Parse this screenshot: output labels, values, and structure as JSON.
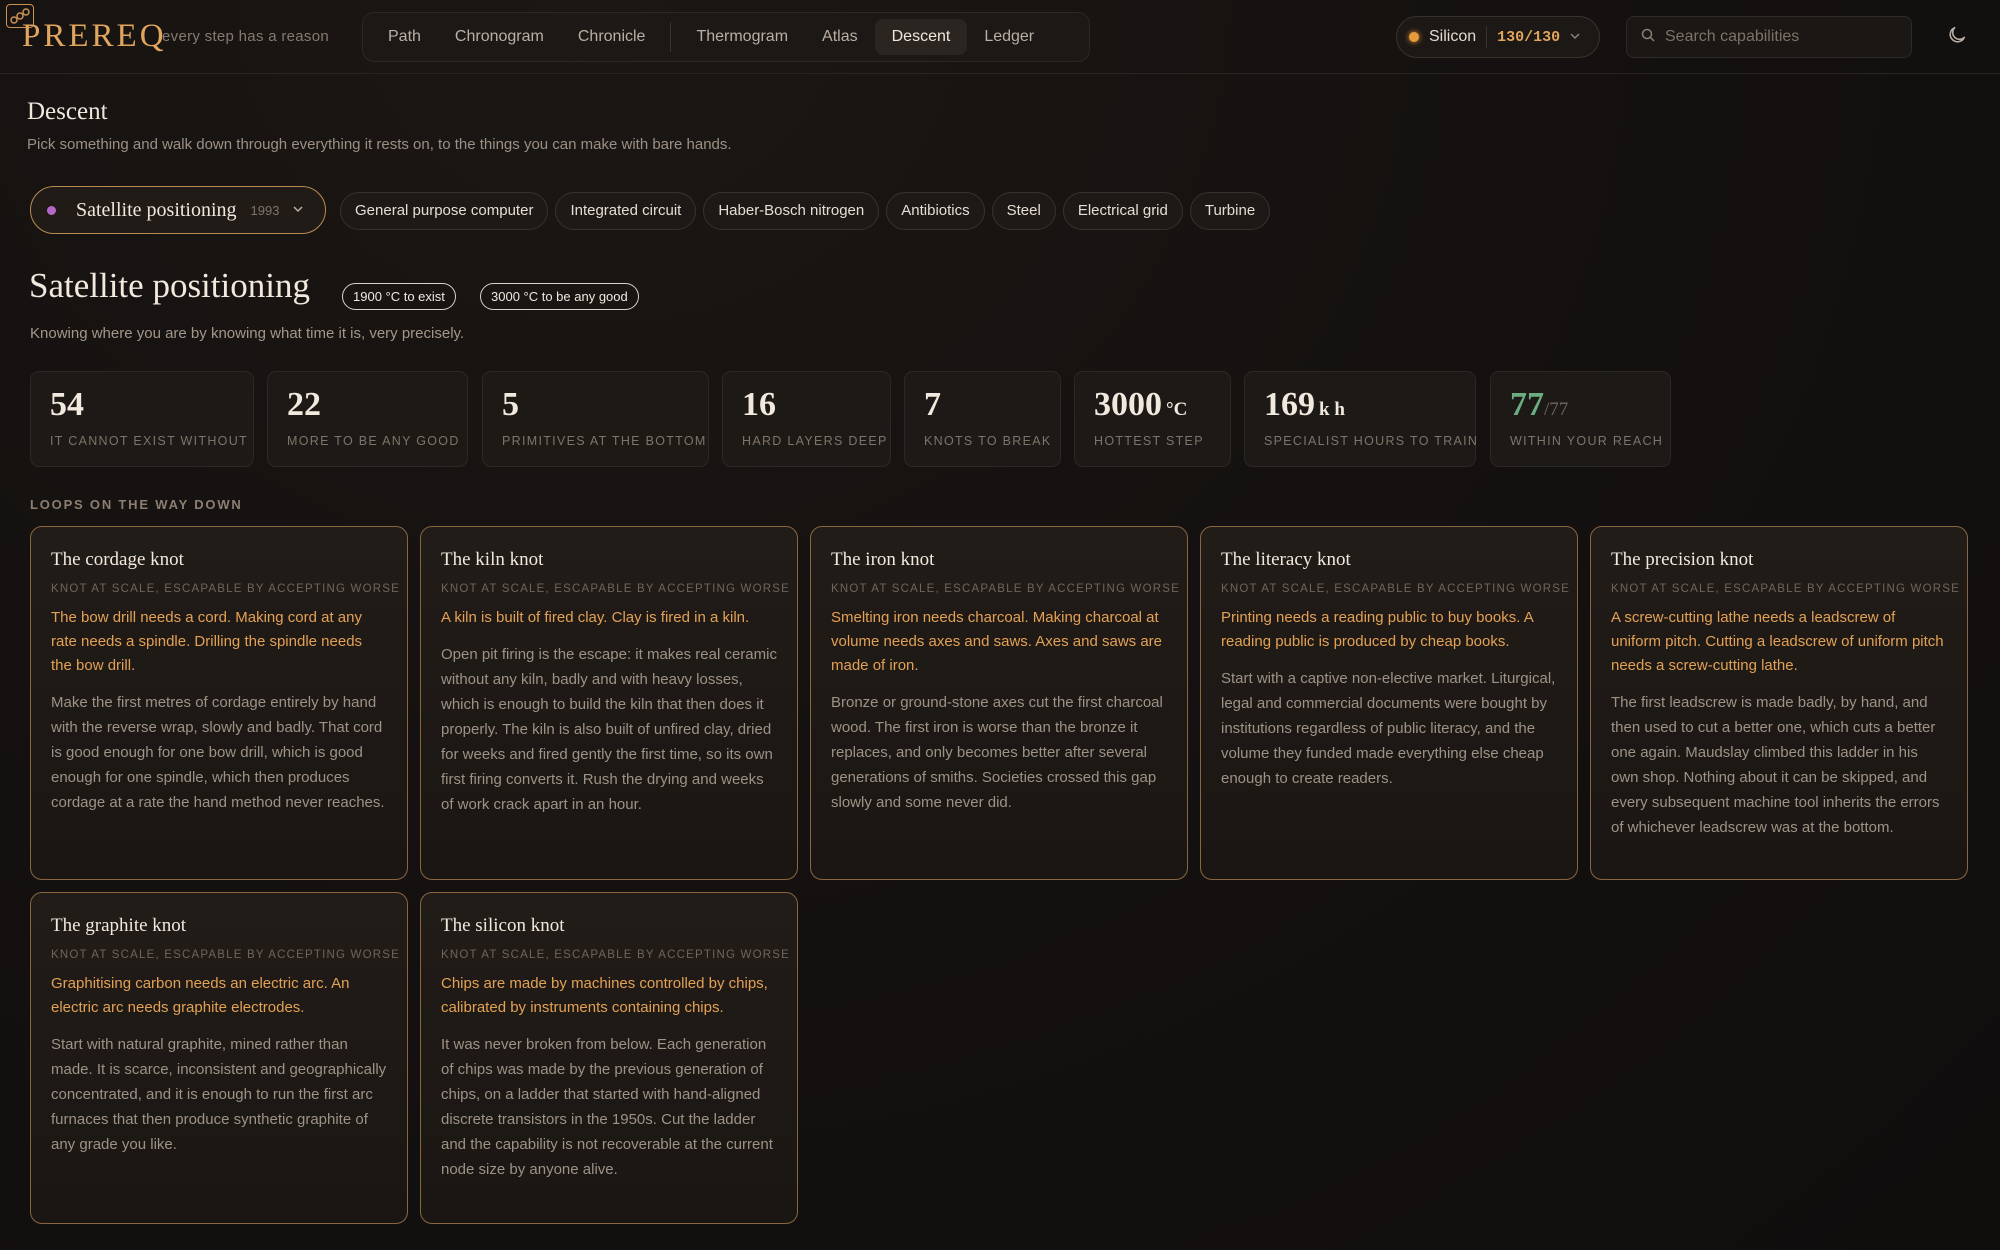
{
  "app": {
    "logo": "PREREQ",
    "tagline": "every step has a reason"
  },
  "nav": {
    "items": [
      "Path",
      "Chronogram",
      "Chronicle",
      "Thermogram",
      "Atlas",
      "Descent",
      "Ledger"
    ],
    "active": "Descent"
  },
  "material": {
    "name": "Silicon",
    "count": "130/130",
    "dot_color": "#e59a3c"
  },
  "search": {
    "placeholder": "Search capabilities",
    "value": ""
  },
  "page": {
    "title": "Descent",
    "subtitle": "Pick something and walk down through everything it rests on, to the things you can make with bare hands."
  },
  "picker": {
    "label": "Satellite positioning",
    "year": "1993"
  },
  "chips": [
    "General purpose computer",
    "Integrated circuit",
    "Haber-Bosch nitrogen",
    "Antibiotics",
    "Steel",
    "Electrical grid",
    "Turbine"
  ],
  "subject": {
    "title": "Satellite positioning",
    "badges": [
      "1900 °C to exist",
      "3000 °C to be any good"
    ],
    "subtitle": "Knowing where you are by knowing what time it is, very precisely."
  },
  "stats": [
    {
      "value": "54",
      "unit": "",
      "label": "IT CANNOT EXIST WITHOUT"
    },
    {
      "value": "22",
      "unit": "",
      "label": "MORE TO BE ANY GOOD"
    },
    {
      "value": "5",
      "unit": "",
      "label": "PRIMITIVES AT THE BOTTOM"
    },
    {
      "value": "16",
      "unit": "",
      "label": "HARD LAYERS DEEP"
    },
    {
      "value": "7",
      "unit": "",
      "label": "KNOTS TO BREAK"
    },
    {
      "value": "3000",
      "unit": "°C",
      "label": "HOTTEST STEP"
    },
    {
      "value": "169",
      "unit": "k h",
      "label": "SPECIALIST HOURS TO TRAIN"
    },
    {
      "value": "77",
      "unit": "/77",
      "label": "WITHIN YOUR REACH"
    }
  ],
  "loops_label": "LOOPS ON THE WAY DOWN",
  "knots": [
    {
      "title": "The cordage knot",
      "tag": "KNOT AT SCALE, ESCAPABLE BY ACCEPTING WORSE",
      "loop": "The bow drill needs a cord. Making cord at any rate needs a spindle. Drilling the spindle needs the bow drill.",
      "body": "Make the first metres of cordage entirely by hand with the reverse wrap, slowly and badly. That cord is good enough for one bow drill, which is good enough for one spindle, which then produces cordage at a rate the hand method never reaches."
    },
    {
      "title": "The kiln knot",
      "tag": "KNOT AT SCALE, ESCAPABLE BY ACCEPTING WORSE",
      "loop": "A kiln is built of fired clay. Clay is fired in a kiln.",
      "body": "Open pit firing is the escape: it makes real ceramic without any kiln, badly and with heavy losses, which is enough to build the kiln that then does it properly. The kiln is also built of unfired clay, dried for weeks and fired gently the first time, so its own first firing converts it. Rush the drying and weeks of work crack apart in an hour."
    },
    {
      "title": "The iron knot",
      "tag": "KNOT AT SCALE, ESCAPABLE BY ACCEPTING WORSE",
      "loop": "Smelting iron needs charcoal. Making charcoal at volume needs axes and saws. Axes and saws are made of iron.",
      "body": "Bronze or ground-stone axes cut the first charcoal wood. The first iron is worse than the bronze it replaces, and only becomes better after several generations of smiths. Societies crossed this gap slowly and some never did."
    },
    {
      "title": "The literacy knot",
      "tag": "KNOT AT SCALE, ESCAPABLE BY ACCEPTING WORSE",
      "loop": "Printing needs a reading public to buy books. A reading public is produced by cheap books.",
      "body": "Start with a captive non-elective market. Liturgical, legal and commercial documents were bought by institutions regardless of public literacy, and the volume they funded made everything else cheap enough to create readers."
    },
    {
      "title": "The precision knot",
      "tag": "KNOT AT SCALE, ESCAPABLE BY ACCEPTING WORSE",
      "loop": "A screw-cutting lathe needs a leadscrew of uniform pitch. Cutting a leadscrew of uniform pitch needs a screw-cutting lathe.",
      "body": "The first leadscrew is made badly, by hand, and then used to cut a better one, which cuts a better one again. Maudslay climbed this ladder in his own shop. Nothing about it can be skipped, and every subsequent machine tool inherits the errors of whichever leadscrew was at the bottom."
    },
    {
      "title": "The graphite knot",
      "tag": "KNOT AT SCALE, ESCAPABLE BY ACCEPTING WORSE",
      "loop": "Graphitising carbon needs an electric arc. An electric arc needs graphite electrodes.",
      "body": "Start with natural graphite, mined rather than made. It is scarce, inconsistent and geographically concentrated, and it is enough to run the first arc furnaces that then produce synthetic graphite of any grade you like."
    },
    {
      "title": "The silicon knot",
      "tag": "KNOT AT SCALE, ESCAPABLE BY ACCEPTING WORSE",
      "loop": "Chips are made by machines controlled by chips, calibrated by instruments containing chips.",
      "body": "It was never broken from below. Each generation of chips was made by the previous generation of chips, on a ladder that started with hand-aligned discrete transistors in the 1950s. Cut the ladder and the capability is not recoverable at the current node size by anyone alive."
    }
  ]
}
